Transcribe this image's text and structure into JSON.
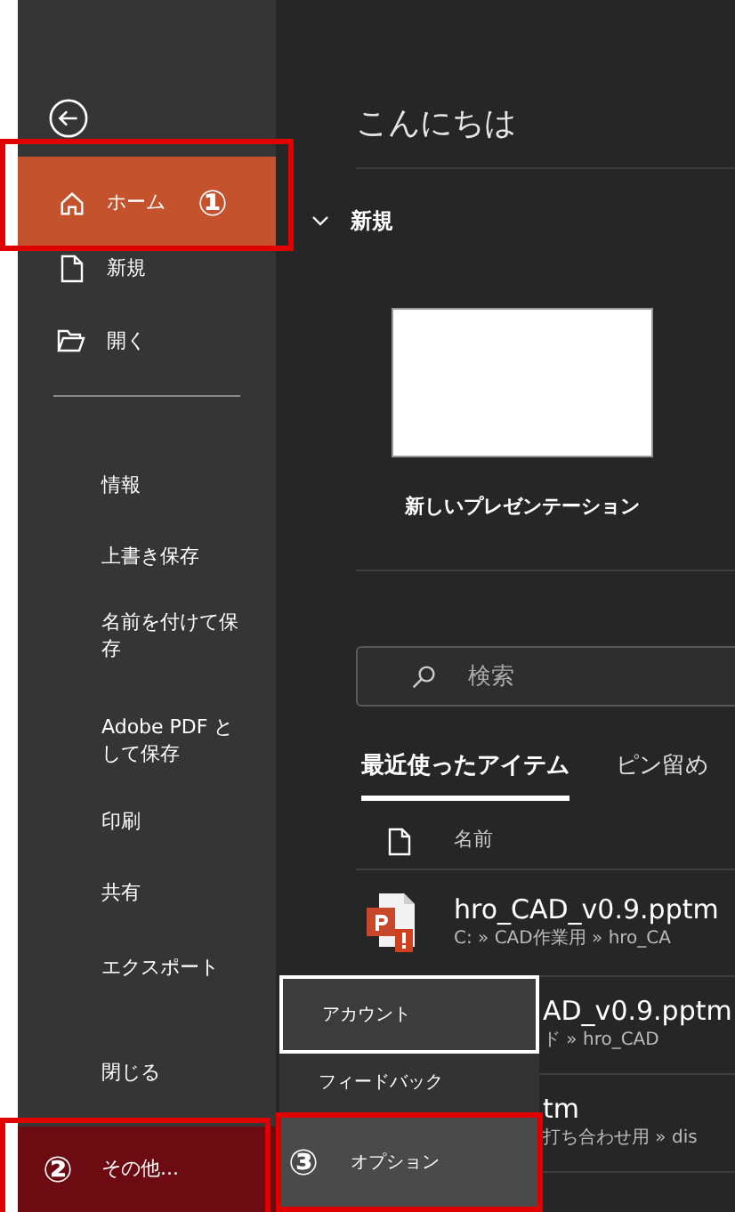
{
  "sidebar": {
    "primary": [
      {
        "label": "ホーム",
        "selected": true,
        "marker": "①",
        "annotated": true
      },
      {
        "label": "新規",
        "selected": false
      },
      {
        "label": "開く",
        "selected": false
      }
    ],
    "secondary": [
      {
        "label": "情報"
      },
      {
        "label": "上書き保存"
      },
      {
        "label": "名前を付けて保存"
      },
      {
        "label": "Adobe PDF として保存"
      },
      {
        "label": "印刷"
      },
      {
        "label": "共有"
      },
      {
        "label": "エクスポート"
      },
      {
        "label": "閉じる"
      }
    ],
    "more": {
      "label": "その他...",
      "selected": true,
      "marker": "②",
      "annotated": true
    }
  },
  "main": {
    "greeting": "こんにちは",
    "new_section": {
      "title": "新規",
      "expanded": true,
      "templates": [
        {
          "label": "新しいプレゼンテーション"
        }
      ]
    },
    "search": {
      "placeholder": "検索"
    },
    "tabs": [
      {
        "label": "最近使ったアイテム",
        "selected": true
      },
      {
        "label": "ピン留め",
        "selected": false
      }
    ],
    "file_list": {
      "columns": [
        "名前"
      ],
      "rows": [
        {
          "kind": "full",
          "name": "hro_CAD_v0.9.pptm",
          "path": "C: » CAD作業用 » hro_CA"
        },
        {
          "kind": "partial",
          "name": "AD_v0.9.pptm",
          "path": "ド » hro_CAD"
        },
        {
          "kind": "partial",
          "name": "tm",
          "path": "打ち合わせ用 » dis"
        }
      ]
    }
  },
  "more_menu": {
    "items": [
      {
        "label": "アカウント",
        "focused": true,
        "selected": false
      },
      {
        "label": "フィードバック",
        "focused": false,
        "selected": false
      },
      {
        "label": "オプション",
        "focused": false,
        "selected": true,
        "marker": "③",
        "annotated": true
      }
    ]
  }
}
